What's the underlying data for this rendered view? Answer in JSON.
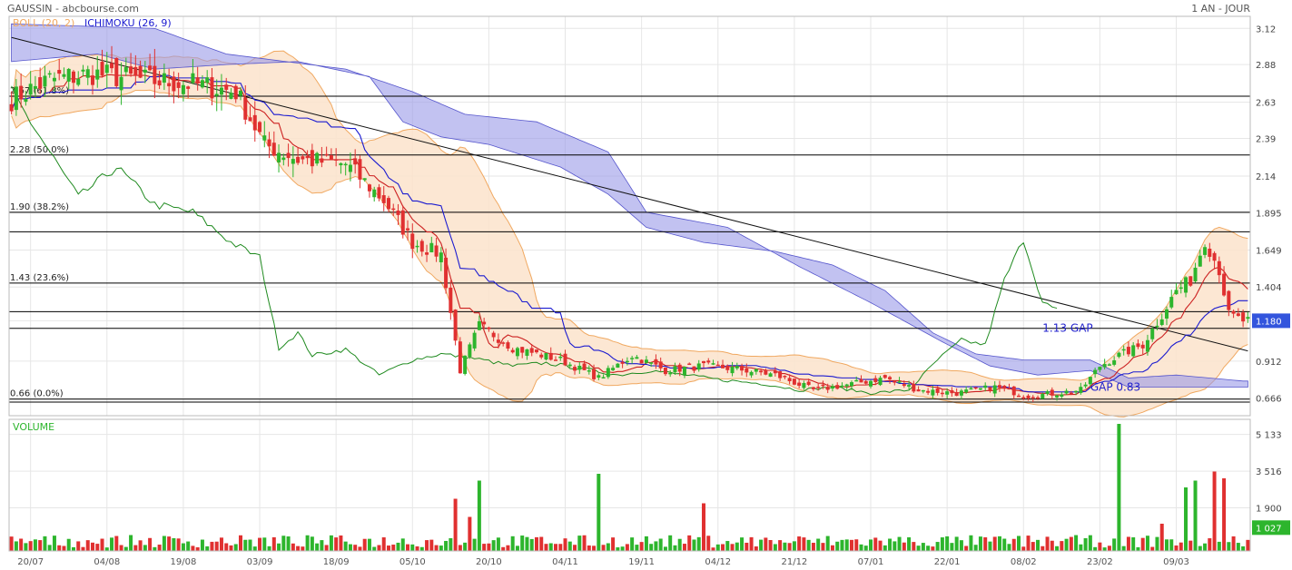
{
  "header": {
    "title": "GAUSSIN - abcbourse.com",
    "period": "1 AN - JOUR"
  },
  "legend": {
    "boll": "BOLL (20, 2)",
    "ichimoku": "ICHIMOKU (26, 9)",
    "volume": "VOLUME"
  },
  "colors": {
    "up": "#2db52d",
    "down": "#e03030",
    "bollFill": "#fbe3cb",
    "bollLine": "#f0a860",
    "cloud": "#9a9ae8",
    "tenkan": "#1a1ad0",
    "kijun": "#cc2020",
    "chikou": "#1f8a1f",
    "grid": "#e6e6e6",
    "level": "#000000",
    "lastPrice": "#3355dd",
    "volLast": "#2db52d",
    "annotation": "#2222cc",
    "accent": "#f0a860"
  },
  "chart_data": [
    {
      "type": "candlestick",
      "title": "GAUSSIN - abcbourse.com",
      "x_tick_labels": [
        "20/07",
        "04/08",
        "19/08",
        "03/09",
        "18/09",
        "05/10",
        "20/10",
        "04/11",
        "19/11",
        "04/12",
        "21/12",
        "07/01",
        "22/01",
        "08/02",
        "23/02",
        "09/03"
      ],
      "y_tick_labels": [
        "3.12",
        "2.88",
        "2.63",
        "2.39",
        "2.14",
        "1.895",
        "1.649",
        "1.404",
        "1.180",
        "0.912",
        "0.666"
      ],
      "y_ticks": [
        3.12,
        2.88,
        2.63,
        2.39,
        2.14,
        1.895,
        1.649,
        1.404,
        1.18,
        0.912,
        0.666
      ],
      "ylim": [
        0.55,
        3.2
      ],
      "last_price": {
        "value": 1.18,
        "label": "1.180"
      },
      "fib_levels": [
        {
          "value": 2.67,
          "label": "2.67  (61.8%)"
        },
        {
          "value": 2.28,
          "label": "2.28  (50.0%)"
        },
        {
          "value": 1.9,
          "label": "1.90  (38.2%)"
        },
        {
          "value": 1.43,
          "label": "1.43  (23.6%)"
        },
        {
          "value": 0.66,
          "label": "0.66  (0.0%)"
        }
      ],
      "unlabeled_levels": [
        1.77,
        1.24,
        1.13,
        0.64
      ],
      "annotations": [
        {
          "text": "1.13  GAP",
          "index": 216,
          "value": 1.13
        },
        {
          "text": "GAP    0.83",
          "index": 226,
          "value": 0.74
        }
      ],
      "trendline": {
        "from": [
          0,
          3.06
        ],
        "to": [
          259,
          0.98
        ]
      },
      "close_anchors": [
        [
          0,
          2.65
        ],
        [
          8,
          2.78
        ],
        [
          17,
          2.82
        ],
        [
          27,
          2.78
        ],
        [
          38,
          2.75
        ],
        [
          47,
          2.7
        ],
        [
          53,
          2.35
        ],
        [
          60,
          2.25
        ],
        [
          70,
          2.22
        ],
        [
          78,
          1.98
        ],
        [
          84,
          1.7
        ],
        [
          90,
          1.62
        ],
        [
          94,
          0.85
        ],
        [
          98,
          1.15
        ],
        [
          105,
          1.0
        ],
        [
          115,
          0.92
        ],
        [
          123,
          0.8
        ],
        [
          130,
          0.95
        ],
        [
          137,
          0.85
        ],
        [
          145,
          0.88
        ],
        [
          152,
          0.86
        ],
        [
          160,
          0.82
        ],
        [
          168,
          0.72
        ],
        [
          176,
          0.76
        ],
        [
          183,
          0.8
        ],
        [
          190,
          0.72
        ],
        [
          198,
          0.7
        ],
        [
          206,
          0.74
        ],
        [
          213,
          0.68
        ],
        [
          219,
          0.7
        ],
        [
          224,
          0.72
        ],
        [
          228,
          0.88
        ],
        [
          232,
          0.95
        ],
        [
          237,
          1.02
        ],
        [
          241,
          1.22
        ],
        [
          244,
          1.38
        ],
        [
          247,
          1.45
        ],
        [
          250,
          1.72
        ],
        [
          253,
          1.52
        ],
        [
          255,
          1.22
        ],
        [
          258,
          1.18
        ]
      ],
      "ichimoku_anchors": {
        "senkouA": [
          [
            0,
            2.9
          ],
          [
            18,
            2.95
          ],
          [
            30,
            2.85
          ],
          [
            45,
            2.88
          ],
          [
            60,
            2.9
          ],
          [
            75,
            2.8
          ],
          [
            82,
            2.5
          ],
          [
            90,
            2.4
          ],
          [
            100,
            2.35
          ],
          [
            115,
            2.2
          ],
          [
            125,
            2.02
          ],
          [
            133,
            1.8
          ],
          [
            145,
            1.7
          ],
          [
            160,
            1.64
          ],
          [
            172,
            1.55
          ],
          [
            183,
            1.38
          ],
          [
            193,
            1.1
          ],
          [
            202,
            0.96
          ],
          [
            212,
            0.92
          ],
          [
            226,
            0.92
          ],
          [
            234,
            0.8
          ],
          [
            244,
            0.82
          ],
          [
            258,
            0.78
          ]
        ],
        "senkouB": [
          [
            0,
            3.15
          ],
          [
            30,
            3.12
          ],
          [
            45,
            2.95
          ],
          [
            70,
            2.85
          ],
          [
            84,
            2.7
          ],
          [
            95,
            2.55
          ],
          [
            110,
            2.5
          ],
          [
            125,
            2.3
          ],
          [
            133,
            1.9
          ],
          [
            150,
            1.8
          ],
          [
            165,
            1.54
          ],
          [
            180,
            1.3
          ],
          [
            195,
            1.04
          ],
          [
            205,
            0.88
          ],
          [
            215,
            0.82
          ],
          [
            226,
            0.85
          ],
          [
            234,
            0.74
          ],
          [
            258,
            0.74
          ]
        ],
        "chikou": [
          [
            0,
            2.7
          ],
          [
            14,
            2.0
          ],
          [
            22,
            2.2
          ],
          [
            30,
            1.95
          ],
          [
            38,
            1.9
          ],
          [
            46,
            1.7
          ],
          [
            52,
            1.6
          ],
          [
            56,
            1.0
          ],
          [
            60,
            1.1
          ],
          [
            63,
            0.95
          ],
          [
            70,
            0.99
          ],
          [
            77,
            0.82
          ],
          [
            84,
            0.92
          ],
          [
            90,
            0.96
          ],
          [
            97,
            0.93
          ],
          [
            105,
            0.88
          ],
          [
            112,
            0.9
          ],
          [
            120,
            0.86
          ],
          [
            127,
            0.82
          ],
          [
            134,
            0.85
          ],
          [
            141,
            0.82
          ],
          [
            148,
            0.79
          ],
          [
            158,
            0.76
          ],
          [
            165,
            0.72
          ],
          [
            172,
            0.74
          ],
          [
            180,
            0.7
          ],
          [
            188,
            0.72
          ],
          [
            194,
            0.92
          ],
          [
            199,
            1.05
          ],
          [
            204,
            1.02
          ],
          [
            208,
            1.45
          ],
          [
            212,
            1.72
          ],
          [
            216,
            1.3
          ],
          [
            219,
            1.25
          ]
        ]
      }
    },
    {
      "type": "bar",
      "title": "VOLUME",
      "y_tick_labels": [
        "5 133",
        "3 516",
        "1 900"
      ],
      "y_ticks": [
        5133,
        3516,
        1900
      ],
      "ylim": [
        0,
        5800
      ],
      "last_volume": {
        "value": 1027,
        "label": "1 027"
      },
      "spikes": [
        {
          "index": 93,
          "value": 2300,
          "dir": "down"
        },
        {
          "index": 96,
          "value": 1500,
          "dir": "down"
        },
        {
          "index": 98,
          "value": 3100,
          "dir": "up"
        },
        {
          "index": 123,
          "value": 3400,
          "dir": "up"
        },
        {
          "index": 145,
          "value": 2100,
          "dir": "down"
        },
        {
          "index": 232,
          "value": 5600,
          "dir": "up"
        },
        {
          "index": 241,
          "value": 1200,
          "dir": "down"
        },
        {
          "index": 246,
          "value": 2800,
          "dir": "up"
        },
        {
          "index": 248,
          "value": 3100,
          "dir": "up"
        },
        {
          "index": 252,
          "value": 3500,
          "dir": "down"
        },
        {
          "index": 254,
          "value": 3200,
          "dir": "down"
        }
      ]
    }
  ]
}
